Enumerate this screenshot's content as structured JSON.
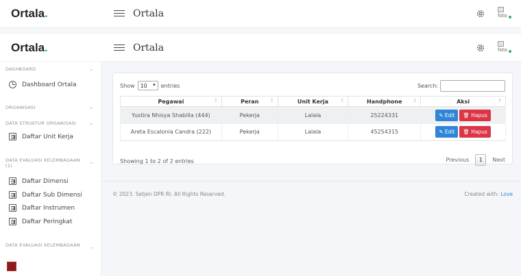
{
  "brand": {
    "name": "Ortala",
    "dot": "."
  },
  "topbar": {
    "title": "Ortala",
    "avatar_alt": "foto"
  },
  "sidebar": {
    "sections": {
      "dashboard": "DASHBOARD",
      "organisasi": "ORGANISASI",
      "struktur": "DATA STRUKTUR ORGANISASI",
      "evaluasi1": "DATA EVALUASI KELEMBAGAAN",
      "evaluasi1_sub": "(1)",
      "evaluasi2": "DATA EVALUASI KELEMBAGAAN"
    },
    "items": {
      "dashboard": "Dashboard Ortala",
      "unit_kerja": "Daftar Unit Kerja",
      "dimensi": "Daftar Dimensi",
      "sub_dimensi": "Daftar Sub Dimensi",
      "instrumen": "Daftar Instrumen",
      "peringkat": "Daftar Peringkat"
    }
  },
  "table_controls": {
    "show": "Show",
    "entries_value": "10",
    "entries": "entries",
    "search": "Search:"
  },
  "table": {
    "headers": [
      "Pegawai",
      "Peran",
      "Unit Kerja",
      "Handphone",
      "Aksi"
    ],
    "rows": [
      {
        "pegawai": "Yustira Nhisya Shabilla (444)",
        "peran": "Pekerja",
        "unit": "Lalala",
        "hp": "25224331"
      },
      {
        "pegawai": "Areta Escalonia Candra (222)",
        "peran": "Pekerja",
        "unit": "Lalala",
        "hp": "45254315"
      }
    ],
    "edit_label": "✎ Edit",
    "hapus_label": "🗑 Hapus"
  },
  "table_info": "Showing 1 to 2 of 2 entries",
  "pagination": {
    "previous": "Previous",
    "page": "1",
    "next": "Next"
  },
  "footer": {
    "copyright": "© 2023. Setjen DPR RI. All Rights Reserved.",
    "created": "Created with: ",
    "love": "Love"
  },
  "colors": {
    "accent": "#1cb0c7",
    "edit": "#2f86d6",
    "danger": "#dc3545"
  }
}
